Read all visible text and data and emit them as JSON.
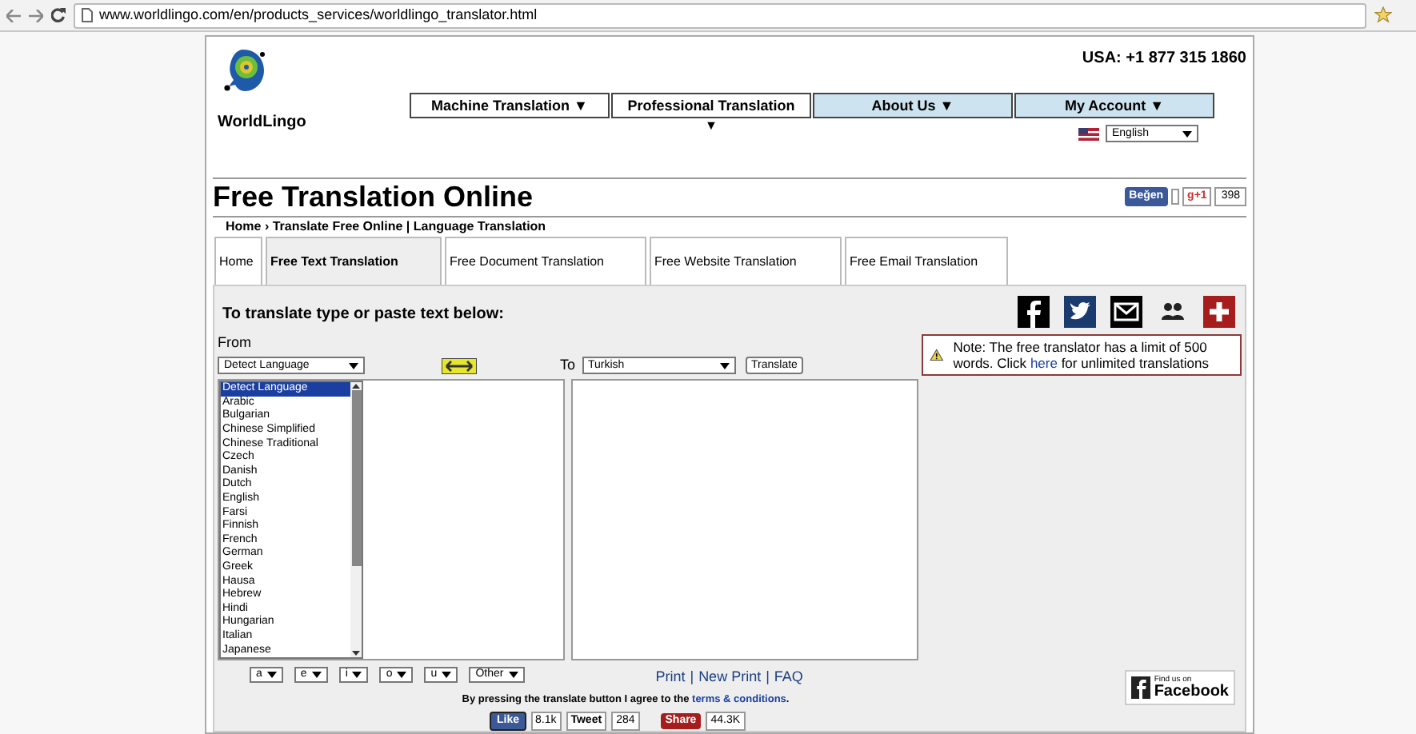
{
  "browser": {
    "url": "www.worldlingo.com/en/products_services/worldlingo_translator.html"
  },
  "header": {
    "logo_text": "WorldLingo",
    "phone": "USA: +1 877 315 1860",
    "nav": [
      {
        "label": "Machine Translation",
        "caret": "▼",
        "highlighted": false
      },
      {
        "label": "Professional Translation",
        "caret": "▼",
        "highlighted": false
      },
      {
        "label": "About Us",
        "caret": "▼",
        "highlighted": true
      },
      {
        "label": "My Account",
        "caret": "▼",
        "highlighted": true
      }
    ],
    "site_language": "English"
  },
  "title": "Free Translation Online",
  "social_top": {
    "like": "Beğen",
    "plus": "g+1",
    "plus_count": "398"
  },
  "breadcrumb": "Home › Translate Free Online | Language Translation",
  "tabs": [
    {
      "label": "Home",
      "selected": false
    },
    {
      "label": "Free Text Translation",
      "selected": true
    },
    {
      "label": "Free Document Translation",
      "selected": false
    },
    {
      "label": "Free Website Translation",
      "selected": false
    },
    {
      "label": "Free Email Translation",
      "selected": false
    }
  ],
  "translator": {
    "heading": "To translate type or paste text below:",
    "from_label": "From",
    "from_value": "Detect Language",
    "languages": [
      {
        "label": "Detect Language",
        "selected": true
      },
      {
        "label": "Arabic",
        "selected": false
      },
      {
        "label": "Bulgarian",
        "selected": false
      },
      {
        "label": "Chinese Simplified",
        "selected": false
      },
      {
        "label": "Chinese Traditional",
        "selected": false
      },
      {
        "label": "Czech",
        "selected": false
      },
      {
        "label": "Danish",
        "selected": false
      },
      {
        "label": "Dutch",
        "selected": false
      },
      {
        "label": "English",
        "selected": false
      },
      {
        "label": "Farsi",
        "selected": false
      },
      {
        "label": "Finnish",
        "selected": false
      },
      {
        "label": "French",
        "selected": false
      },
      {
        "label": "German",
        "selected": false
      },
      {
        "label": "Greek",
        "selected": false
      },
      {
        "label": "Hausa",
        "selected": false
      },
      {
        "label": "Hebrew",
        "selected": false
      },
      {
        "label": "Hindi",
        "selected": false
      },
      {
        "label": "Hungarian",
        "selected": false
      },
      {
        "label": "Italian",
        "selected": false
      },
      {
        "label": "Japanese",
        "selected": false
      }
    ],
    "to_label": "To",
    "to_value": "Turkish",
    "translate_button": "Translate"
  },
  "note": {
    "text_before": "Note: The free translator has a limit of 500 words. Click ",
    "link": "here",
    "text_after": " for unlimited translations"
  },
  "accents": [
    "a",
    "e",
    "i",
    "o",
    "u",
    "Other"
  ],
  "footer_links": [
    "Print",
    "New Print",
    "FAQ"
  ],
  "footer_separator": "|",
  "agree": {
    "text": "By pressing the translate button I agree to the ",
    "link": "terms & conditions",
    "end": "."
  },
  "share": {
    "like": "Like",
    "like_count": "8.1k",
    "tweet": "Tweet",
    "tweet_count": "284",
    "share": "Share",
    "share_count": "44.3K"
  },
  "facebook_badge": {
    "small": "Find us on",
    "big": "Facebook"
  }
}
